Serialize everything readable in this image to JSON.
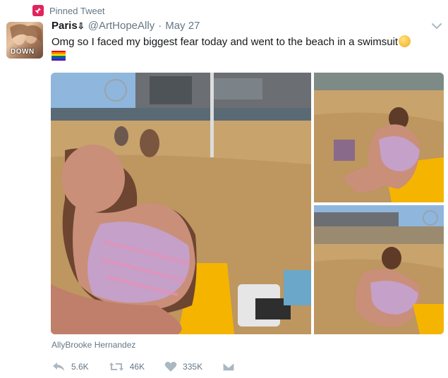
{
  "pinned": {
    "label": "Pinned Tweet",
    "icon": "pin-icon"
  },
  "author": {
    "avatar_text": "DOWN",
    "name": "Paris",
    "name_emoji": "⇩",
    "handle": "@ArtHopeAlly",
    "separator": "·",
    "date": "May 27"
  },
  "tweet": {
    "text": "Omg so I faced my biggest fear today and went to the beach in a swimsuit",
    "emoji": "relieved-face-emoji",
    "flag": "rainbow-flag-emoji"
  },
  "photo_credit": "AllyBrooke Hernandez",
  "actions": {
    "reply": {
      "count": "5.6K",
      "icon": "reply-icon"
    },
    "retweet": {
      "count": "46K",
      "icon": "retweet-icon"
    },
    "like": {
      "count": "335K",
      "icon": "heart-icon"
    },
    "dm": {
      "icon": "direct-message-icon"
    }
  },
  "colors": {
    "pin": "#e0245e",
    "secondary_text": "#657786",
    "primary_text": "#14171a",
    "sand": "#c8a36c",
    "sky": "#8fb6dd",
    "towel": "#f5b400"
  }
}
